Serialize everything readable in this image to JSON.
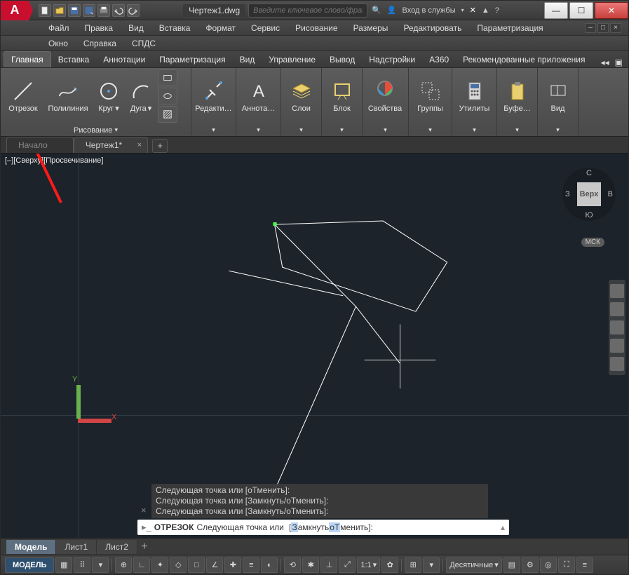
{
  "app": {
    "logo": "A"
  },
  "titlebar": {
    "doc_title": "Чертеж1.dwg",
    "search_placeholder": "Введите ключевое слово/фразу",
    "signin": "Вход в службы"
  },
  "menubar": {
    "items": [
      "Файл",
      "Правка",
      "Вид",
      "Вставка",
      "Формат",
      "Сервис",
      "Рисование",
      "Размеры",
      "Редактировать",
      "Параметризация"
    ],
    "items2": [
      "Окно",
      "Справка",
      "СПДС"
    ]
  },
  "ribbon_tabs": {
    "items": [
      "Главная",
      "Вставка",
      "Аннотации",
      "Параметризация",
      "Вид",
      "Управление",
      "Вывод",
      "Надстройки",
      "A360",
      "Рекомендованные приложения"
    ],
    "active_index": 0
  },
  "ribbon": {
    "draw_panel": {
      "label": "Рисование",
      "buttons": [
        {
          "name": "line",
          "label": "Отрезок"
        },
        {
          "name": "polyline",
          "label": "Полилиния"
        },
        {
          "name": "circle",
          "label": "Круг"
        },
        {
          "name": "arc",
          "label": "Дуга"
        }
      ]
    },
    "panels": [
      {
        "name": "modify",
        "label": "Редакти…"
      },
      {
        "name": "annotation",
        "label": "Аннота…"
      },
      {
        "name": "layers",
        "label": "Слои"
      },
      {
        "name": "block",
        "label": "Блок"
      },
      {
        "name": "properties",
        "label": "Свойства"
      },
      {
        "name": "groups",
        "label": "Группы"
      },
      {
        "name": "utilities",
        "label": "Утилиты"
      },
      {
        "name": "clipboard",
        "label": "Буфе…"
      },
      {
        "name": "view",
        "label": "Вид"
      }
    ]
  },
  "file_tabs": {
    "items": [
      {
        "label": "Начало",
        "active": false
      },
      {
        "label": "Чертеж1*",
        "active": true
      }
    ]
  },
  "canvas": {
    "view_label": "[–][Сверху][Просвечивание]",
    "viewcube": {
      "face": "Верх",
      "n": "С",
      "s": "Ю",
      "w": "З",
      "e": "В"
    },
    "wcs": "МСК",
    "ucs": {
      "x": "X",
      "y": "Y"
    }
  },
  "command": {
    "history": [
      "Следующая точка или [оТменить]:",
      "Следующая точка или [Замкнуть/оТменить]:",
      "Следующая точка или [Замкнуть/оТменить]:"
    ],
    "current_cmd": "ОТРЕЗОК",
    "current_prompt": "Следующая точка или",
    "opt_open": "[",
    "opt1_hl": "З",
    "opt1": "амкнуть",
    "opt_sep": " ",
    "opt2_hl": "оТ",
    "opt2": "менить",
    "opt_close": "]:"
  },
  "layout_tabs": {
    "items": [
      "Модель",
      "Лист1",
      "Лист2"
    ],
    "active_index": 0
  },
  "statusbar": {
    "model": "МОДЕЛЬ",
    "scale": "1:1",
    "units": "Десятичные"
  }
}
